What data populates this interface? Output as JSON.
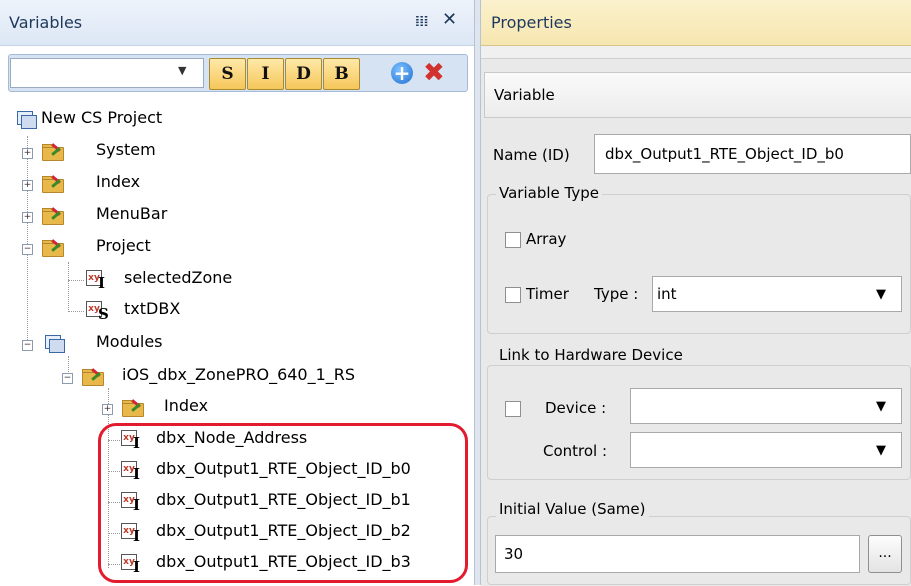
{
  "variables_panel": {
    "title": "Variables",
    "pin_icon": "pin-icon",
    "close_icon": "close-icon",
    "toolbar": {
      "filter_value": "",
      "type_buttons": [
        "S",
        "I",
        "D",
        "B"
      ],
      "add_icon": "add-icon",
      "delete_icon": "delete-icon"
    },
    "tree": {
      "root": "New CS Project",
      "system": "System",
      "index": "Index",
      "menubar": "MenuBar",
      "project": "Project",
      "selected_zone": "selectedZone",
      "txt_dbx": "txtDBX",
      "modules": "Modules",
      "module_name": "iOS_dbx_ZonePRO_640_1_RS",
      "module_index": "Index",
      "vars": [
        "dbx_Node_Address",
        "dbx_Output1_RTE_Object_ID_b0",
        "dbx_Output1_RTE_Object_ID_b1",
        "dbx_Output1_RTE_Object_ID_b2",
        "dbx_Output1_RTE_Object_ID_b3"
      ],
      "var_type_letters": {
        "int": "I",
        "string": "S"
      }
    }
  },
  "properties_panel": {
    "title": "Properties",
    "section": "Variable",
    "name_label": "Name (ID)",
    "name_value": "dbx_Output1_RTE_Object_ID_b0",
    "variable_type_group": "Variable Type",
    "array_label": "Array",
    "array_checked": false,
    "timer_label": "Timer",
    "timer_checked": false,
    "type_label": "Type :",
    "type_value": "int",
    "link_group": "Link to Hardware Device",
    "link_checked": false,
    "device_label": "Device :",
    "device_value": "",
    "control_label": "Control :",
    "control_value": "",
    "initial_group": "Initial Value (Same)",
    "initial_value": "30",
    "browse_label": "..."
  },
  "colors": {
    "highlight": "#e21b2e",
    "variables_header": "#dce7f5",
    "properties_header": "#f6e6b0",
    "type_button": "#f5c65a"
  }
}
